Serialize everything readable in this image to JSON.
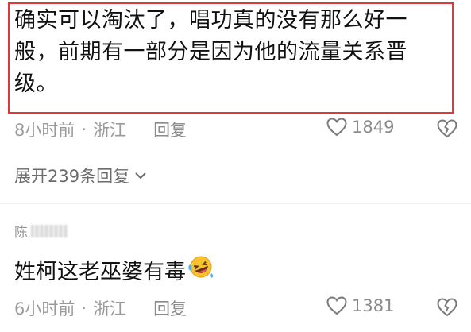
{
  "comment1": {
    "text": "确实可以淘汰了，唱功真的没有那么好一般，前期有一部分是因为他的流量关系晋级。",
    "time": "8小时前",
    "separator": "·",
    "location": "浙江",
    "reply_label": "回复",
    "likes": "1849"
  },
  "expand_replies_label": "展开239条回复",
  "comment2": {
    "username_visible": "陈",
    "text": "姓柯这老巫婆有毒",
    "emoji_icon": "rolling-on-floor-laughing-emoji",
    "time": "6小时前",
    "separator": "·",
    "location": "浙江",
    "reply_label": "回复",
    "likes": "1381"
  },
  "colors": {
    "highlight_border": "#e0383a",
    "meta_text": "#9a9a9a"
  }
}
